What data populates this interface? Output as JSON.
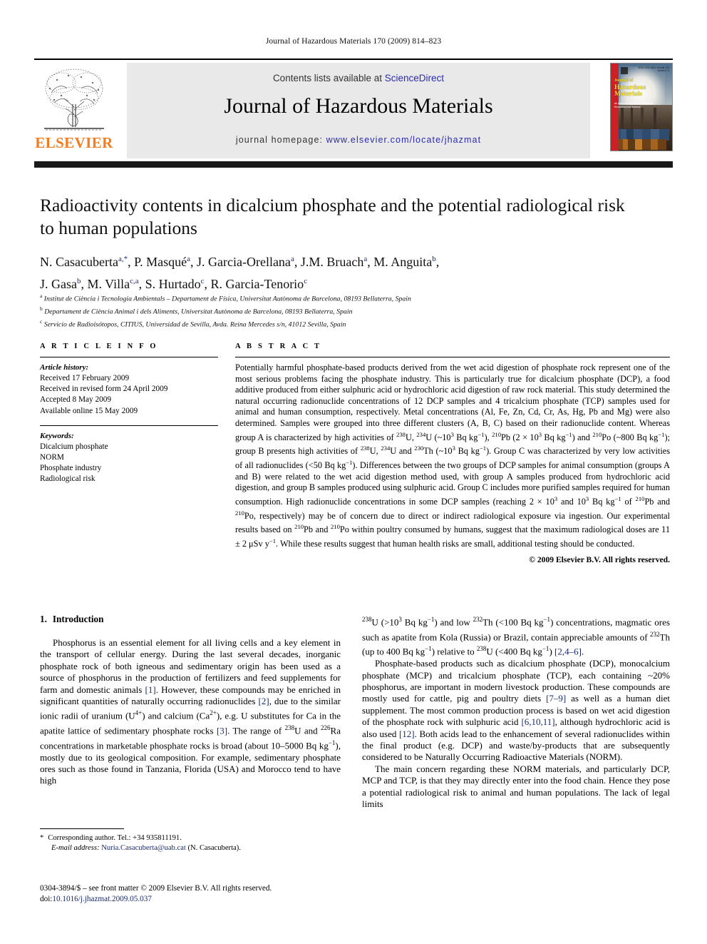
{
  "running_head": "Journal of Hazardous Materials 170 (2009) 814–823",
  "masthead": {
    "contents_prefix": "Contents lists available at ",
    "sciencedirect": "ScienceDirect",
    "journal_name": "Journal of Hazardous Materials",
    "homepage_prefix": "journal homepage: ",
    "homepage_url": "www.elsevier.com/locate/jhazmat",
    "publisher": "ELSEVIER",
    "publisher_color": "#F47C20",
    "link_color": "#2b2bb0",
    "cover": {
      "line1": "Journal of",
      "line2": "Hazardous",
      "line3": "Materials",
      "subtitle": "an international journal devoted to\nEnvironmental Science",
      "top_note": "ISSN 0304-3894\nVolume 170 Issues 2–3"
    }
  },
  "article": {
    "title": "Radioactivity contents in dicalcium phosphate and the potential radiological risk to human populations",
    "authors_line1": "N. Casacuberta a,*, P. Masqué a, J. Garcia-Orellana a, J.M. Bruach a, M. Anguita b,",
    "authors_line2": "J. Gasa b, M. Villa c,a, S. Hurtado c, R. Garcia-Tenorio c",
    "affiliations": [
      "Institut de Ciència i Tecnologia Ambientals – Departament de Física, Universitat Autònoma de Barcelona, 08193 Bellaterra, Spain",
      "Departament de Ciència Animal i dels Aliments, Universitat Autònoma de Barcelona, 08193 Bellaterra, Spain",
      "Servicio de Radioisótopos, CITIUS, Universidad de Sevilla, Avda. Reina Mercedes s/n, 41012 Sevilla, Spain"
    ],
    "affiliation_marks": [
      "a",
      "b",
      "c"
    ]
  },
  "article_info": {
    "heading": "A R T I C L E   I N F O",
    "history_label": "Article history:",
    "history": [
      "Received 17 February 2009",
      "Received in revised form 24 April 2009",
      "Accepted 8 May 2009",
      "Available online 15 May 2009"
    ],
    "keywords_label": "Keywords:",
    "keywords": [
      "Dicalcium phosphate",
      "NORM",
      "Phosphate industry",
      "Radiological risk"
    ]
  },
  "abstract": {
    "heading": "A B S T R A C T",
    "paragraphs": [
      "Potentially harmful phosphate-based products derived from the wet acid digestion of phosphate rock represent one of the most serious problems facing the phosphate industry. This is particularly true for dicalcium phosphate (DCP), a food additive produced from either sulphuric acid or hydrochloric acid digestion of raw rock material. This study determined the natural occurring radionuclide concentrations of 12 DCP samples and 4 tricalcium phosphate (TCP) samples used for animal and human consumption, respectively. Metal concentrations (Al, Fe, Zn, Cd, Cr, As, Hg, Pb and Mg) were also determined. Samples were grouped into three different clusters (A, B, C) based on their radionuclide content. Whereas group A is characterized by high activities of 238U, 234U (~103 Bq kg−1), 210Pb (2 × 103 Bq kg−1) and 210Po (~800 Bq kg−1); group B presents high activities of 238U, 234U and 230Th (~103 Bq kg−1). Group C was characterized by very low activities of all radionuclides (<50 Bq kg−1). Differences between the two groups of DCP samples for animal consumption (groups A and B) were related to the wet acid digestion method used, with group A samples produced from hydrochloric acid digestion, and group B samples produced using sulphuric acid. Group C includes more purified samples required for human consumption. High radionuclide concentrations in some DCP samples (reaching 2 × 103 and 103 Bq kg−1 of 210Pb and 210Po, respectively) may be of concern due to direct or indirect radiological exposure via ingestion. Our experimental results based on 210Pb and 210Po within poultry consumed by humans, suggest that the maximum radiological doses are 11 ± 2 μSv y−1. While these results suggest that human health risks are small, additional testing should be conducted."
    ],
    "copyright": "© 2009 Elsevier B.V. All rights reserved."
  },
  "introduction": {
    "number": "1.",
    "heading": "Introduction",
    "paragraph1": "Phosphorus is an essential element for all living cells and a key element in the transport of cellular energy. During the last several decades, inorganic phosphate rock of both igneous and sedimentary origin has been used as a source of phosphorus in the production of fertilizers and feed supplements for farm and domestic animals [1]. However, these compounds may be enriched in significant quantities of naturally occurring radionuclides [2], due to the similar ionic radii of uranium (U4+) and calcium (Ca2+), e.g. U substitutes for Ca in the apatite lattice of sedimentary phosphate rocks [3]. The range of 238U and 226Ra concentrations in marketable phosphate rocks is broad (about 10–5000 Bq kg−1), mostly due to its geological composition. For example, sedimentary phosphate ores such as those found in Tanzania, Florida (USA) and Morocco tend to have high 238U (>103 Bq kg−1) and low 232Th (<100 Bq kg−1) concentrations, magmatic ores such as apatite from Kola (Russia) or Brazil, contain appreciable amounts of 232Th (up to 400 Bq kg−1) relative to 238U (<400 Bq kg−1) [2,4–6].",
    "paragraph2": "Phosphate-based products such as dicalcium phosphate (DCP), monocalcium phosphate (MCP) and tricalcium phosphate (TCP), each containing ~20% phosphorus, are important in modern livestock production. These compounds are mostly used for cattle, pig and poultry diets [7–9] as well as a human diet supplement. The most common production process is based on wet acid digestion of the phosphate rock with sulphuric acid [6,10,11], although hydrochloric acid is also used [12]. Both acids lead to the enhancement of several radionuclides within the final product (e.g. DCP) and waste/by-products that are subsequently considered to be Naturally Occurring Radioactive Materials (NORM).",
    "paragraph3": "The main concern regarding these NORM materials, and particularly DCP, MCP and TCP, is that they may directly enter into the food chain. Hence they pose a potential radiological risk to animal and human populations. The lack of legal limits"
  },
  "footnote": {
    "star": "*",
    "corresponding": "Corresponding author. Tel.: +34 935811191.",
    "email_label": "E-mail address:",
    "email": "Nuria.Casacuberta@uab.cat",
    "email_owner": "(N. Casacuberta)."
  },
  "imprint": {
    "line1": "0304-3894/$ – see front matter © 2009 Elsevier B.V. All rights reserved.",
    "doi_label": "doi:",
    "doi": "10.1016/j.jhazmat.2009.05.037"
  }
}
